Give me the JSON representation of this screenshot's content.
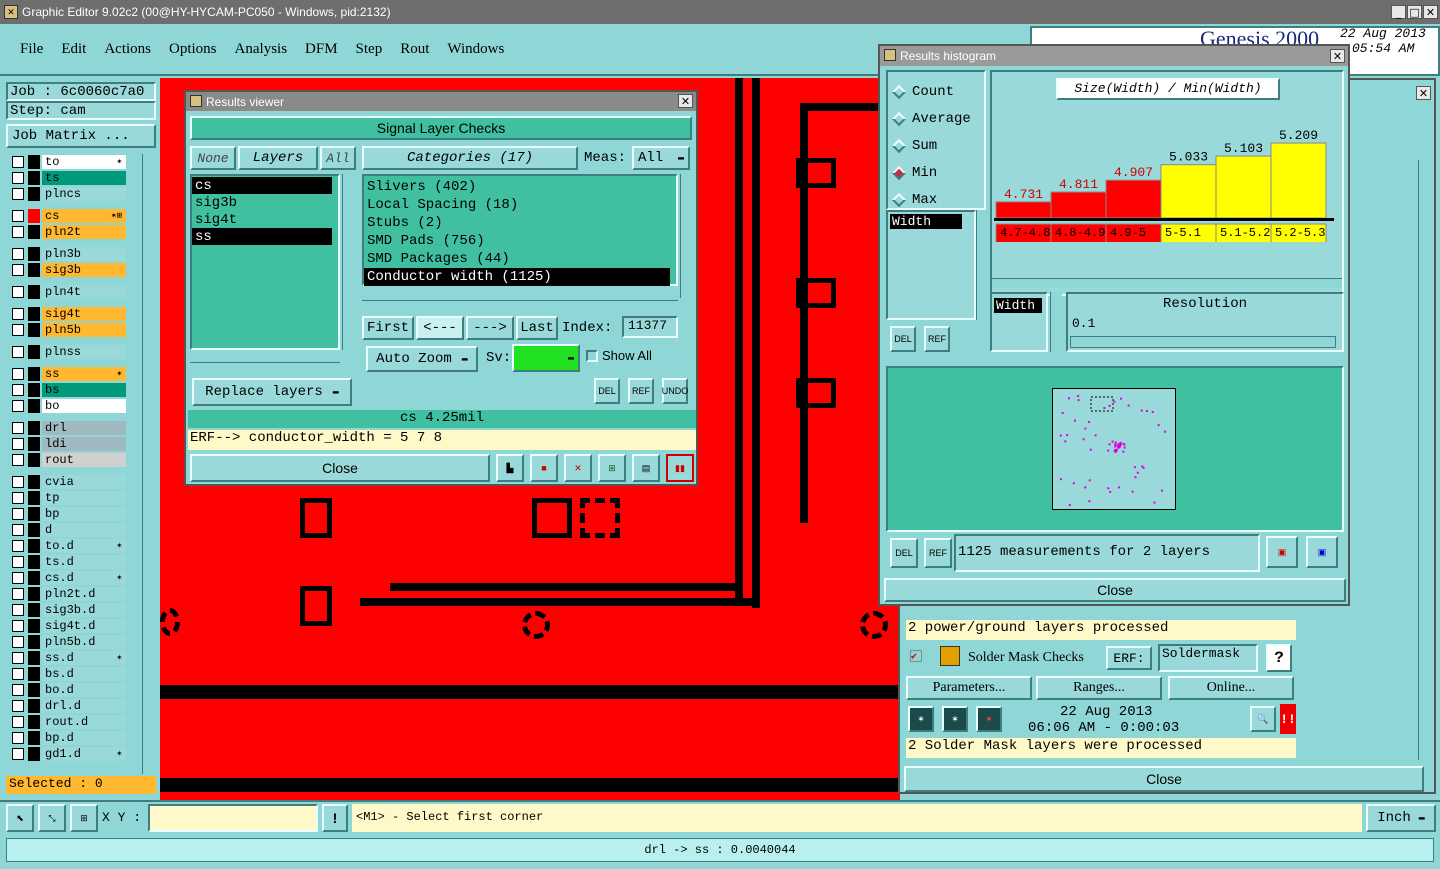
{
  "app_title": "Graphic Editor 9.02c2 (00@HY-HYCAM-PC050 - Windows, pid:2132)",
  "menu": [
    "File",
    "Edit",
    "Actions",
    "Options",
    "Analysis",
    "DFM",
    "Step",
    "Rout",
    "Windows"
  ],
  "brand": "Genesis 2000",
  "date_line1": "22 Aug 2013",
  "date_line2": "05:54 AM",
  "job_label": "Job : 6c0060c7a0",
  "step_label": "Step: cam",
  "job_matrix": "Job Matrix ...",
  "layers": [
    {
      "name": "to",
      "color": "#ffffff",
      "mark": "✶"
    },
    {
      "name": "ts",
      "color": "#009a7a",
      "mark": ""
    },
    {
      "name": "plncs",
      "color": "#9ad9d9",
      "mark": ""
    },
    {
      "name": "cs",
      "color": "#ffb830",
      "mark": "✶⊞"
    },
    {
      "name": "pln2t",
      "color": "#ffb830",
      "mark": ""
    },
    {
      "name": "pln3b",
      "color": "#9ad9d9",
      "mark": ""
    },
    {
      "name": "sig3b",
      "color": "#ffb830",
      "mark": ""
    },
    {
      "name": "pln4t",
      "color": "#9ad9d9",
      "mark": ""
    },
    {
      "name": "sig4t",
      "color": "#ffb830",
      "mark": ""
    },
    {
      "name": "pln5b",
      "color": "#ffb830",
      "mark": ""
    },
    {
      "name": "plnss",
      "color": "#9ad9d9",
      "mark": ""
    },
    {
      "name": "ss",
      "color": "#ffb830",
      "mark": "✶"
    },
    {
      "name": "bs",
      "color": "#009a7a",
      "mark": ""
    },
    {
      "name": "bo",
      "color": "#ffffff",
      "mark": ""
    },
    {
      "name": "drl",
      "color": "#a0b8c0",
      "mark": ""
    },
    {
      "name": "ldi",
      "color": "#a0b8c0",
      "mark": ""
    },
    {
      "name": "rout",
      "color": "#d0d0d0",
      "mark": ""
    },
    {
      "name": "cvia",
      "color": "#9ad9d9",
      "mark": ""
    },
    {
      "name": "tp",
      "color": "#9ad9d9",
      "mark": ""
    },
    {
      "name": "bp",
      "color": "#9ad9d9",
      "mark": ""
    },
    {
      "name": "d",
      "color": "#9ad9d9",
      "mark": ""
    },
    {
      "name": "to.d",
      "color": "#9ad9d9",
      "mark": "✶"
    },
    {
      "name": "ts.d",
      "color": "#9ad9d9",
      "mark": ""
    },
    {
      "name": "cs.d",
      "color": "#9ad9d9",
      "mark": "✶"
    },
    {
      "name": "pln2t.d",
      "color": "#9ad9d9",
      "mark": ""
    },
    {
      "name": "sig3b.d",
      "color": "#9ad9d9",
      "mark": ""
    },
    {
      "name": "sig4t.d",
      "color": "#9ad9d9",
      "mark": ""
    },
    {
      "name": "pln5b.d",
      "color": "#9ad9d9",
      "mark": ""
    },
    {
      "name": "ss.d",
      "color": "#9ad9d9",
      "mark": "✶"
    },
    {
      "name": "bs.d",
      "color": "#9ad9d9",
      "mark": ""
    },
    {
      "name": "bo.d",
      "color": "#9ad9d9",
      "mark": ""
    },
    {
      "name": "drl.d",
      "color": "#9ad9d9",
      "mark": ""
    },
    {
      "name": "rout.d",
      "color": "#9ad9d9",
      "mark": ""
    },
    {
      "name": "bp.d",
      "color": "#9ad9d9",
      "mark": ""
    },
    {
      "name": "gd1.d",
      "color": "#9ad9d9",
      "mark": "✶"
    }
  ],
  "selected": "Selected : 0",
  "bottom": {
    "xy_label": "X Y :",
    "xy_value": "",
    "prompt": "<M1> - Select first corner",
    "units": "Inch",
    "status": "drl -> ss : 0.0040044"
  },
  "results_viewer": {
    "title": "Results viewer",
    "header": "Signal Layer Checks",
    "none_btn": "None",
    "layers_btn": "Layers",
    "all_btn": "All",
    "categories_btn": "Categories (17)",
    "meas_label": "Meas:",
    "meas_value": "All",
    "layer_list": [
      "cs",
      "sig3b",
      "sig4t",
      "ss"
    ],
    "categories": [
      "Slivers (402)",
      "Local Spacing (18)",
      "Stubs (2)",
      "SMD Pads (756)",
      "SMD Packages (44)",
      "Conductor width (1125)"
    ],
    "first": "First",
    "prev": "<---",
    "next": "--->",
    "last": "Last",
    "index_label": "Index:",
    "index_value": "11377",
    "auto_zoom": "Auto Zoom",
    "sv_label": "Sv:",
    "show_all": "Show All",
    "replace_layers": "Replace layers",
    "del": "DEL",
    "ref": "REF",
    "undo": "UNDO",
    "info": "cs 4.25mil",
    "erf": "ERF--> conductor_width = 5 7 8",
    "close": "Close"
  },
  "histogram": {
    "title": "Results histogram",
    "stats": [
      "Count",
      "Average",
      "Sum",
      "Min",
      "Max"
    ],
    "selected_stat": "Min",
    "chart_title": "Size(Width) / Min(Width)",
    "param": "Width",
    "width_tag": "Width",
    "resolution_label": "Resolution",
    "resolution_value": "0.1",
    "del": "DEL",
    "ref": "REF",
    "summary": "1125 measurements for 2 layers",
    "close": "Close"
  },
  "chart_data": {
    "type": "bar",
    "title": "Size(Width) / Min(Width)",
    "categories": [
      "4.7-4.8",
      "4.8-4.9",
      "4.9-5",
      "5-5.1",
      "5.1-5.2",
      "5.2-5.3"
    ],
    "values": [
      4.731,
      4.811,
      4.907,
      5.033,
      5.103,
      5.209
    ],
    "bar_colors": [
      "#ff0000",
      "#ff0000",
      "#ff0000",
      "#ffff00",
      "#ffff00",
      "#ffff00"
    ],
    "label_colors": [
      "#cc0000",
      "#cc0000",
      "#cc0000",
      "#000000",
      "#000000",
      "#000000"
    ]
  },
  "checks": {
    "pg_text": "2 power/ground layers processed",
    "solder_title": "Solder Mask Checks",
    "erf_label": "ERF:",
    "erf_value": "Soldermask",
    "help": "?",
    "parameters": "Parameters...",
    "ranges": "Ranges...",
    "online": "Online...",
    "date": "22 Aug 2013",
    "time": "06:06 AM - 0:00:03",
    "sm_text": "2 Solder Mask layers were processed",
    "close": "Close"
  }
}
